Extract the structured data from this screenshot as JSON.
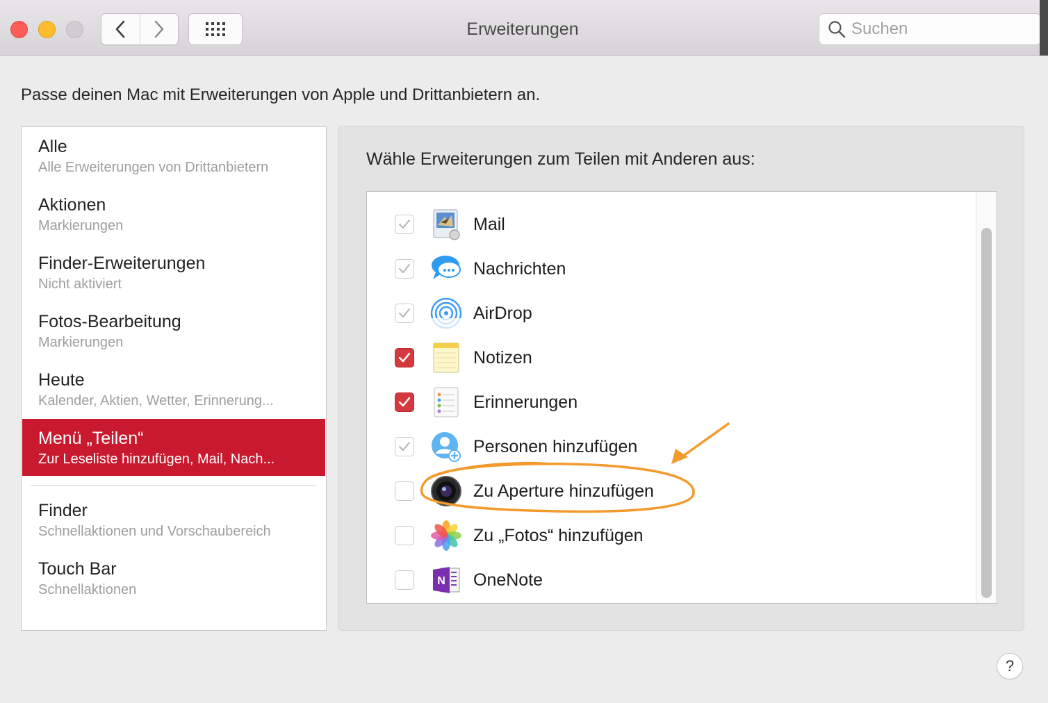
{
  "window": {
    "title": "Erweiterungen",
    "search_placeholder": "Suchen",
    "help_label": "?"
  },
  "intro": "Passe deinen Mac mit Erweiterungen von Apple und Drittanbietern an.",
  "sidebar": {
    "items": [
      {
        "title": "Alle",
        "subtitle": "Alle Erweiterungen von Drittanbietern"
      },
      {
        "title": "Aktionen",
        "subtitle": "Markierungen"
      },
      {
        "title": "Finder-Erweiterungen",
        "subtitle": "Nicht aktiviert"
      },
      {
        "title": "Fotos-Bearbeitung",
        "subtitle": "Markierungen"
      },
      {
        "title": "Heute",
        "subtitle": "Kalender, Aktien, Wetter, Erinnerung..."
      },
      {
        "title": "Menü „Teilen“",
        "subtitle": "Zur Leseliste hinzufügen, Mail, Nach..."
      },
      {
        "title": "Finder",
        "subtitle": "Schnellaktionen und Vorschaubereich"
      },
      {
        "title": "Touch Bar",
        "subtitle": "Schnellaktionen"
      }
    ],
    "selected_index": 5
  },
  "panel": {
    "heading": "Wähle Erweiterungen zum Teilen mit Anderen aus:",
    "extensions": [
      {
        "label": "Mail",
        "state": "checked-disabled",
        "icon": "mail-icon"
      },
      {
        "label": "Nachrichten",
        "state": "checked-disabled",
        "icon": "messages-icon"
      },
      {
        "label": "AirDrop",
        "state": "checked-disabled",
        "icon": "airdrop-icon"
      },
      {
        "label": "Notizen",
        "state": "checked",
        "icon": "notes-icon"
      },
      {
        "label": "Erinnerungen",
        "state": "checked",
        "icon": "reminders-icon"
      },
      {
        "label": "Personen hinzufügen",
        "state": "checked-disabled",
        "icon": "add-people-icon"
      },
      {
        "label": "Zu Aperture hinzufügen",
        "state": "unchecked",
        "icon": "aperture-icon"
      },
      {
        "label": "Zu „Fotos“ hinzufügen",
        "state": "unchecked",
        "icon": "photos-icon"
      },
      {
        "label": "OneNote",
        "state": "unchecked",
        "icon": "onenote-icon"
      }
    ]
  },
  "colors": {
    "selection": "#c8192e",
    "checkbox_on": "#d33a3f",
    "annotation": "#f39a2c"
  }
}
